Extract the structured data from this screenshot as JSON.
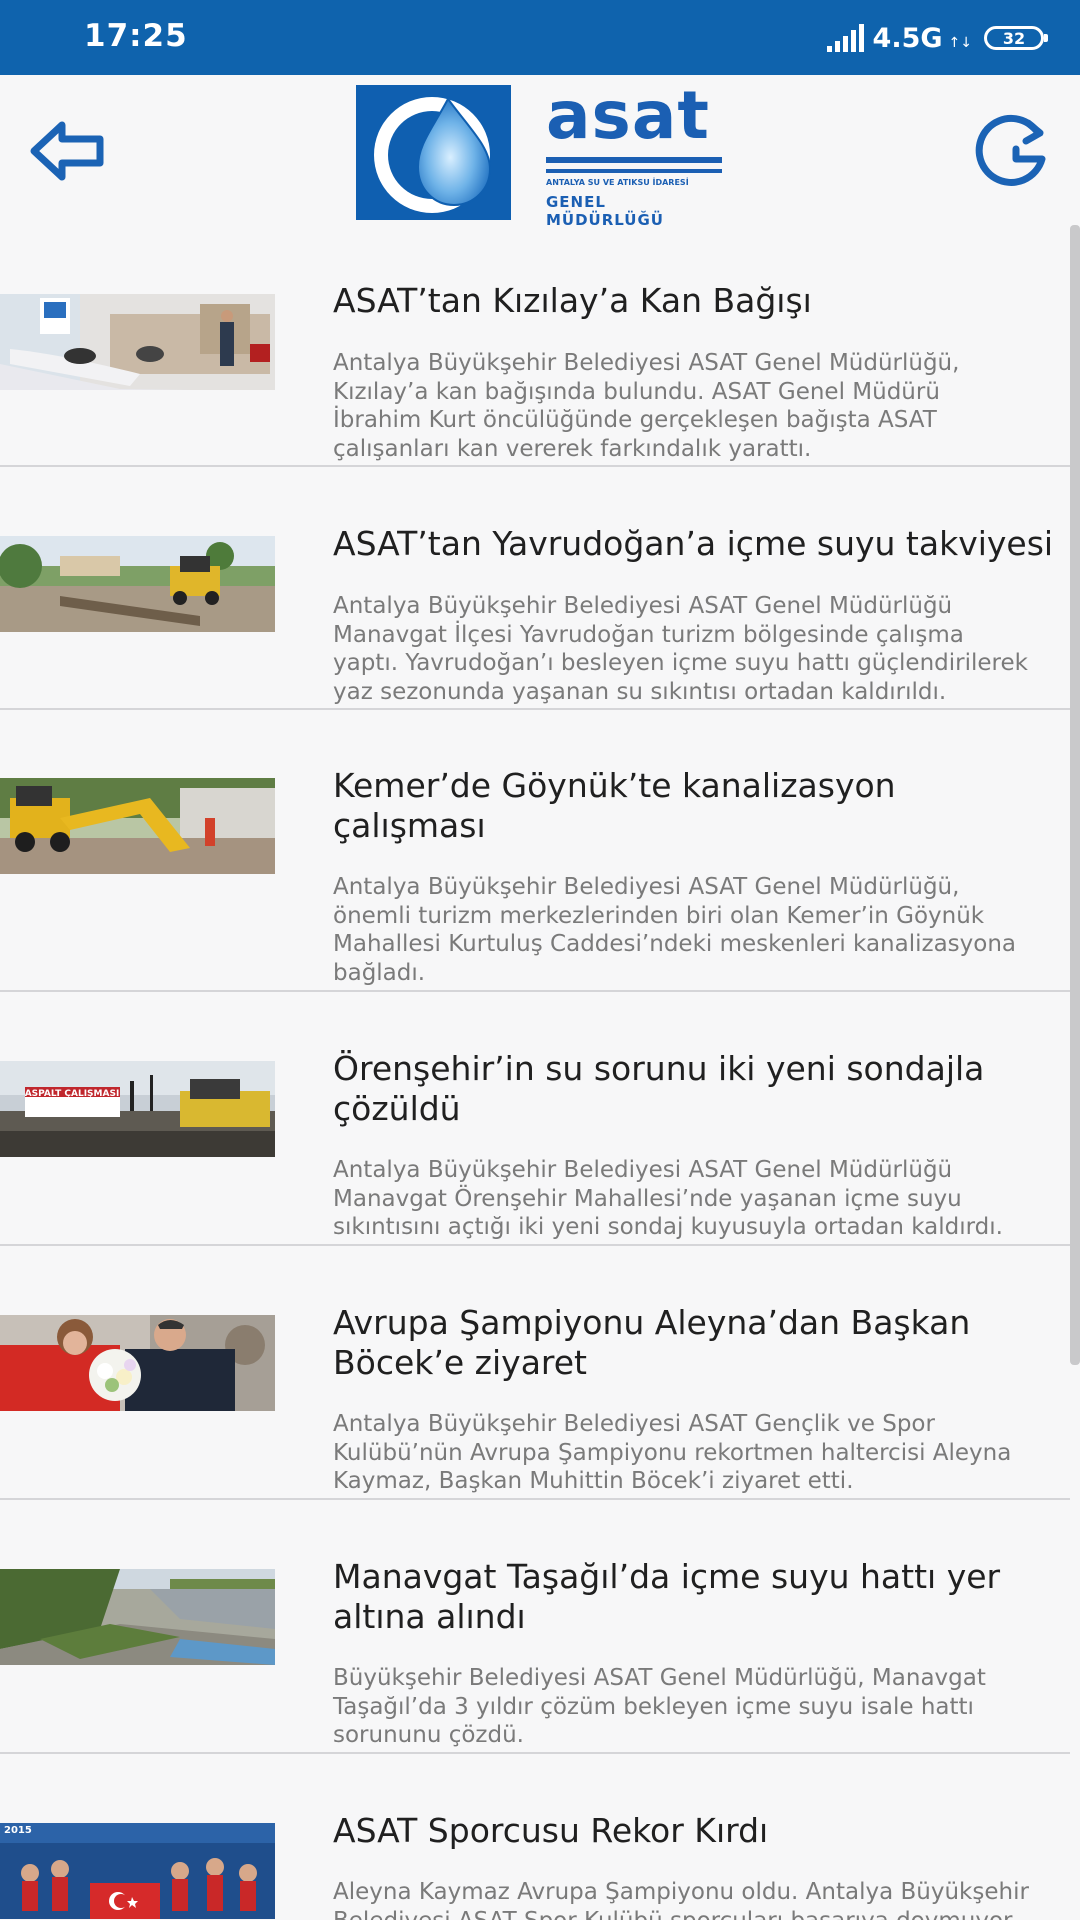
{
  "status_bar": {
    "time": "17:25",
    "network": "4.5G",
    "network_sub": "↑↓",
    "battery": "32"
  },
  "header": {
    "logo": {
      "word": "asat",
      "line1": "ANTALYA SU VE ATIKSU İDARESİ",
      "line2": "GENEL MÜDÜRLÜĞÜ"
    },
    "back_icon": "arrow-left-icon",
    "refresh_icon": "refresh-g-icon",
    "accent_color": "#0f63ad"
  },
  "news": [
    {
      "title": "ASAT’tan Kızılay’a Kan Bağışı",
      "desc": "Antalya Büyükşehir Belediyesi ASAT Genel Müdürlüğü,\nKızılay’a kan bağışında bulundu. ASAT Genel Müdürü\nİbrahim Kurt öncülüğünde gerçekleşen bağışta ASAT\nçalışanları kan vererek farkındalık yarattı."
    },
    {
      "title": "ASAT’tan Yavrudoğan’a içme suyu takviyesi",
      "desc": "Antalya Büyükşehir Belediyesi ASAT Genel Müdürlüğü\nManavgat İlçesi Yavrudoğan turizm bölgesinde çalışma\nyaptı. Yavrudoğan’ı besleyen içme suyu hattı güçlendirilerek\nyaz sezonunda yaşanan su sıkıntısı ortadan kaldırıldı."
    },
    {
      "title": "Kemer’de Göynük’te kanalizasyon\nçalışması",
      "desc": "Antalya Büyükşehir Belediyesi ASAT Genel Müdürlüğü,\nönemli turizm merkezlerinden biri olan Kemer’in Göynük\nMahallesi Kurtuluş Caddesi’ndeki meskenleri kanalizasyona\nbağladı."
    },
    {
      "title": "Örenşehir’in su sorunu iki yeni sondajla\nçözüldü",
      "desc": "Antalya Büyükşehir Belediyesi ASAT Genel Müdürlüğü\nManavgat Örenşehir Mahallesi’nde yaşanan içme suyu\nsıkıntısını açtığı iki yeni sondaj kuyusuyla ortadan kaldırdı."
    },
    {
      "title": "Avrupa Şampiyonu Aleyna’dan Başkan\nBöcek’e ziyaret",
      "desc": "Antalya Büyükşehir Belediyesi ASAT Gençlik ve Spor\nKulübü’nün Avrupa Şampiyonu rekortmen haltercisi Aleyna\nKaymaz, Başkan Muhittin Böcek’i ziyaret etti."
    },
    {
      "title": "Manavgat Taşağıl’da içme suyu hattı yer\naltına alındı",
      "desc": "Büyükşehir Belediyesi ASAT Genel Müdürlüğü, Manavgat\nTaşağıl’da 3 yıldır çözüm bekleyen içme suyu isale hattı\nsorununu çözdü."
    },
    {
      "title": "ASAT Sporcusu Rekor Kırdı",
      "desc": "Aleyna Kaymaz Avrupa Şampiyonu oldu. Antalya Büyükşehir\nBelediyesi ASAT Spor Kulübü sporcuları başarıya doymuyor."
    }
  ],
  "thumb_sign_text": "ASPALT ÇALIŞMASI",
  "thumb_banner_text": "2015"
}
